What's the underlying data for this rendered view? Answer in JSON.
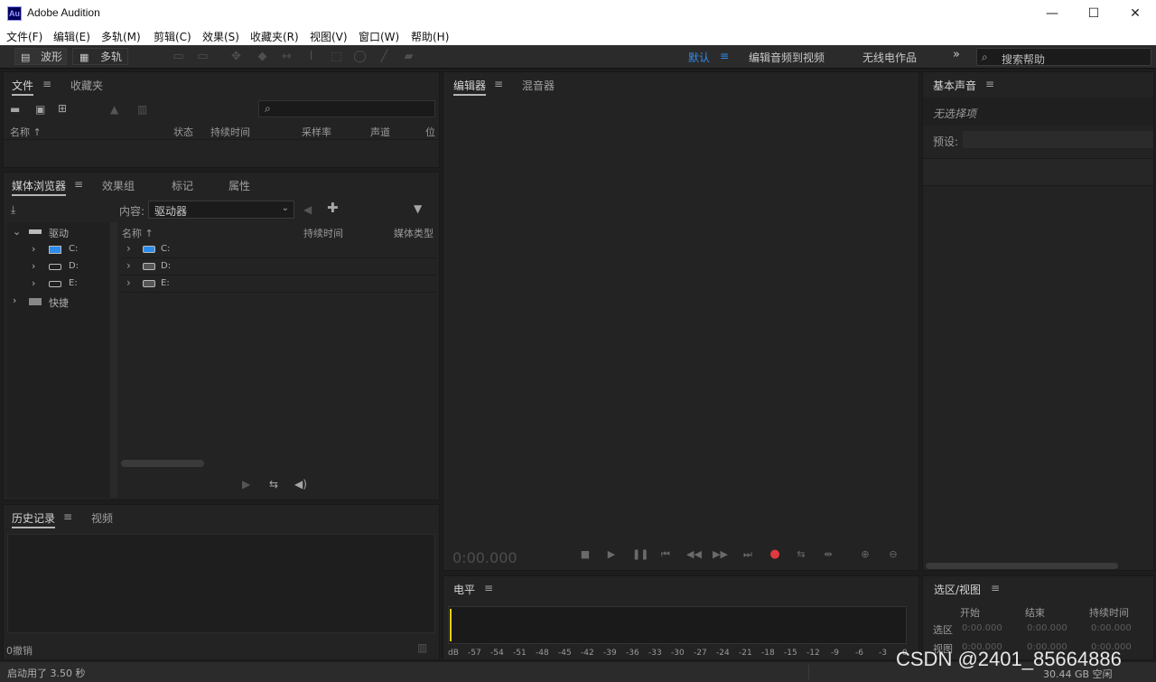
{
  "window": {
    "title": "Adobe Audition",
    "logo_text": "Au",
    "minimize": "—",
    "maximize": "☐",
    "close": "✕"
  },
  "menu": [
    "文件(F)",
    "编辑(E)",
    "多轨(M)",
    "剪辑(C)",
    "效果(S)",
    "收藏夹(R)",
    "视图(V)",
    "窗口(W)",
    "帮助(H)"
  ],
  "toolbar": {
    "waveform_label": "波形",
    "multitrack_label": "多轨",
    "workspaces": {
      "default": "默认",
      "edit_to_video": "编辑音频到视频",
      "radio": "无线电作品"
    },
    "more": "»",
    "search_placeholder": "搜索帮助"
  },
  "files_panel": {
    "tabs": {
      "files": "文件",
      "favorites": "收藏夹"
    },
    "search_icon": "⌕",
    "columns": {
      "name": "名称 ↑",
      "status": "状态",
      "duration": "持续时间",
      "sample_rate": "采样率",
      "channels": "声道",
      "bits": "位"
    }
  },
  "media_browser": {
    "tabs": {
      "media": "媒体浏览器",
      "effects": "效果组",
      "markers": "标记",
      "properties": "属性"
    },
    "content_label": "内容:",
    "content_value": "驱动器",
    "tree": {
      "drives": "驱动",
      "c": "C:",
      "d": "D:",
      "e": "E:",
      "shortcuts": "快捷"
    },
    "columns": {
      "name": "名称 ↑",
      "duration": "持续时间",
      "media_type": "媒体类型"
    },
    "rows": [
      "C:",
      "D:",
      "E:"
    ]
  },
  "history_panel": {
    "tabs": {
      "history": "历史记录",
      "video": "视频"
    },
    "undo_count": "0撤销"
  },
  "editor_panel": {
    "tabs": {
      "editor": "编辑器",
      "mixer": "混音器"
    },
    "time": "0:00.000"
  },
  "level_panel": {
    "title": "电平",
    "ticks": [
      "dB",
      "-57",
      "-54",
      "-51",
      "-48",
      "-45",
      "-42",
      "-39",
      "-36",
      "-33",
      "-30",
      "-27",
      "-24",
      "-21",
      "-18",
      "-15",
      "-12",
      "-9",
      "-6",
      "-3",
      "0"
    ]
  },
  "essential_sound": {
    "title": "基本声音",
    "no_selection": "无选择项",
    "preset_label": "预设:"
  },
  "selection_view": {
    "title": "选区/视图",
    "columns": {
      "start": "开始",
      "end": "结束",
      "duration": "持续时间"
    },
    "rows": [
      {
        "label": "选区",
        "start": "0:00.000",
        "end": "0:00.000",
        "duration": "0:00.000"
      },
      {
        "label": "视图",
        "start": "0:00.000",
        "end": "0:00.000",
        "duration": "0:00.000"
      }
    ]
  },
  "status": {
    "launch_time": "启动用了 3.50 秒",
    "free_space": "30.44 GB 空闲"
  },
  "watermark": "CSDN @2401_85664886",
  "colors": {
    "accent_blue": "#2d8ceb",
    "record_red": "#e0393e",
    "playhead_yellow": "#e6d200"
  }
}
